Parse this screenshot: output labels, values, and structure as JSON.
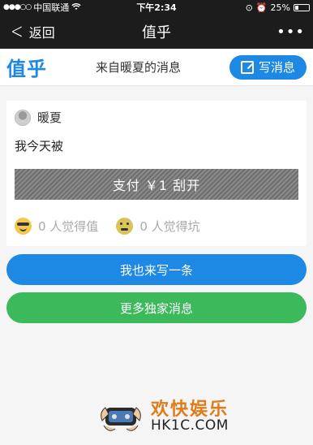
{
  "status_bar": {
    "carrier": "中国联通",
    "time": "下午2:34",
    "battery": "25%",
    "battery_level": 0.25
  },
  "nav": {
    "back_label": "返回",
    "title": "值乎",
    "more_icon": "more-icon"
  },
  "header": {
    "logo": "值乎",
    "subtitle": "来自暖夏的消息",
    "write_label": "写消息"
  },
  "message": {
    "author": "暖夏",
    "content": "我今天被",
    "scratch_label": "支付 ￥1 刮开",
    "worth_label": "0 人觉得值",
    "trap_label": "0 人觉得坑"
  },
  "actions": {
    "write_one_label": "我也来写一条",
    "more_label": "更多独家消息"
  },
  "watermark": {
    "cn": "欢快娱乐",
    "en": "HK1C.COM"
  },
  "colors": {
    "accent": "#1e88e5",
    "green": "#3cb95a",
    "bar": "#1c1c1c",
    "watermark_orange": "#e07b1a"
  }
}
